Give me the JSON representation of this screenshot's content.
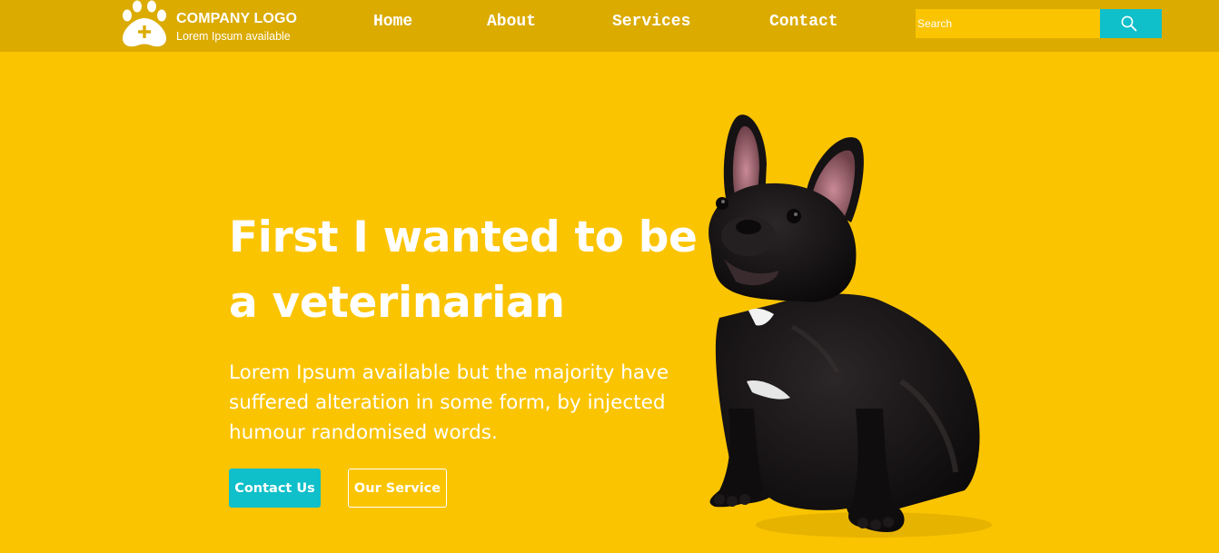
{
  "header": {
    "logo": {
      "title": "COMPANY LOGO",
      "tagline": "Lorem Ipsum available",
      "icon": "paw-plus-icon"
    },
    "nav": [
      {
        "label": "Home"
      },
      {
        "label": "About"
      },
      {
        "label": "Services"
      },
      {
        "label": "Contact"
      }
    ],
    "search": {
      "placeholder": "Search",
      "value": "",
      "button_icon": "search-icon"
    }
  },
  "hero": {
    "title": "First I wanted to be a veterinarian",
    "text": "Lorem Ipsum available but the majority have suffered alteration in some form, by injected humour randomised words.",
    "primary_button": "Contact Us",
    "secondary_button": "Our Service",
    "image": "french-bulldog-image"
  },
  "colors": {
    "background": "#fbc400",
    "navbar": "#dbab00",
    "accent": "#0fbfc9",
    "text": "#ffffff"
  }
}
